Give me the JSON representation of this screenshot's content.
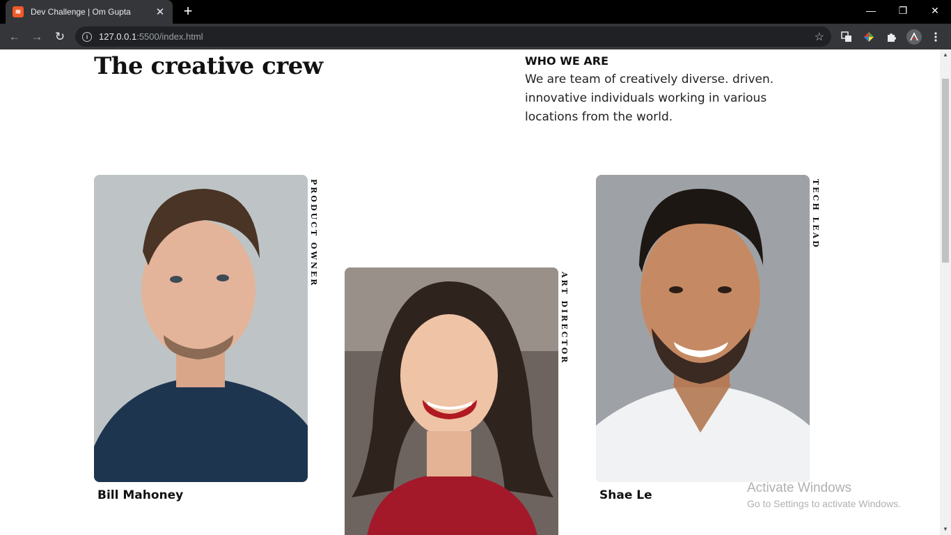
{
  "browser": {
    "tab_title": "Dev Challenge | Om Gupta",
    "tab_close": "✕",
    "new_tab": "+",
    "url_host": "127.0.0.1",
    "url_path": ":5500/index.html",
    "window_controls": {
      "minimize": "—",
      "restore": "❐",
      "close": "✕"
    },
    "nav": {
      "back": "←",
      "forward": "→",
      "reload": "↻"
    },
    "extensions": [
      "copy-extension-icon",
      "color-picker-extension-icon",
      "puzzle-extensions-icon",
      "profile-avatar",
      "menu-dots-icon"
    ]
  },
  "page": {
    "title": "The creative crew",
    "who_heading": "WHO WE ARE",
    "who_text": "We are team of creatively diverse. driven. innovative individuals working in various locations from the world.",
    "members": [
      {
        "name": "Bill Mahoney",
        "role": "PRODUCT OWNER"
      },
      {
        "name": "",
        "role": "ART DIRECTOR"
      },
      {
        "name": "Shae Le",
        "role": "TECH LEAD"
      }
    ]
  },
  "os_overlay": {
    "activate_title": "Activate Windows",
    "activate_sub": "Go to Settings to activate Windows."
  },
  "colors": {
    "tab_bg": "#35363a",
    "toolbar_bg": "#35363a",
    "omnibox_bg": "#202124",
    "favicon": "#f05a28",
    "text_dark": "#111111"
  }
}
